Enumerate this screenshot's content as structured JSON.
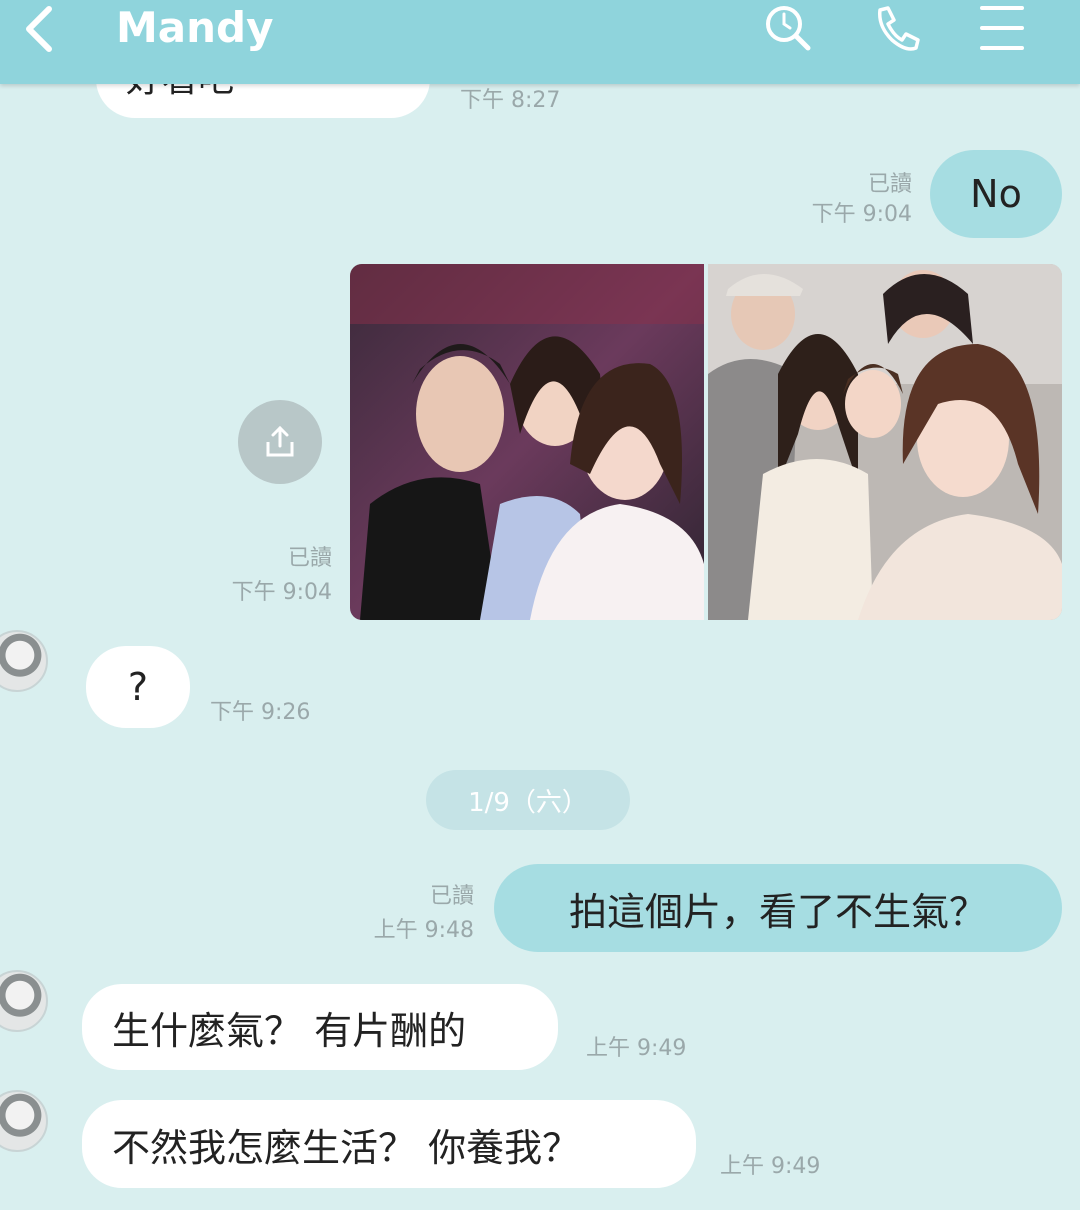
{
  "header": {
    "title": "Mandy",
    "back_icon": "chevron-left-icon",
    "icons": [
      "search-icon",
      "phone-icon",
      "menu-icon"
    ]
  },
  "colors": {
    "header_bg": "#8fd4dc",
    "chat_bg": "#d9efef",
    "outgoing_bubble": "#a6dde2",
    "incoming_bubble": "#ffffff"
  },
  "messages": {
    "m0": {
      "text": "好看吧",
      "time": "下午 8:27"
    },
    "m1": {
      "text": "No",
      "read": "已讀",
      "time": "下午 9:04"
    },
    "m2": {
      "read": "已讀",
      "time": "下午 9:04"
    },
    "m3": {
      "text": "?",
      "time": "下午 9:26"
    },
    "date": "1/9（六）",
    "m4": {
      "text": "拍這個片，看了不生氣？",
      "read": "已讀",
      "time": "上午 9:48"
    },
    "m5": {
      "text": "生什麼氣？ 有片酬的",
      "time": "上午 9:49"
    },
    "m6": {
      "text": "不然我怎麼生活？ 你養我？",
      "time": "上午 9:49"
    }
  }
}
